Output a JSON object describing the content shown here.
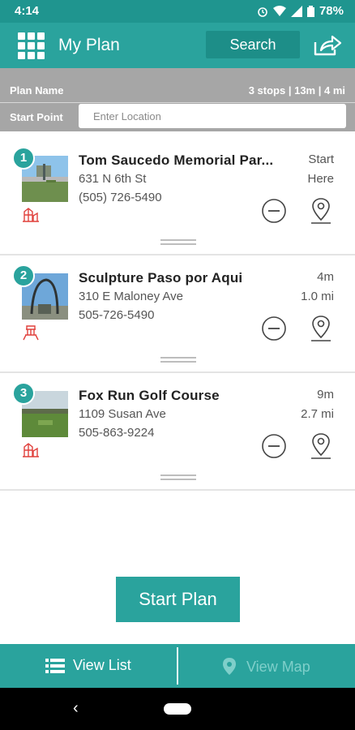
{
  "status": {
    "time": "4:14",
    "battery": "78%"
  },
  "header": {
    "title": "My Plan",
    "search_label": "Search"
  },
  "plan": {
    "name_label": "Plan Name",
    "stats": "3 stops | 13m | 4 mi",
    "start_label": "Start Point",
    "start_placeholder": "Enter Location"
  },
  "stops": [
    {
      "num": "1",
      "name": "Tom Saucedo Memorial Par...",
      "address": "631 N 6th St",
      "phone": "(505) 726-5490",
      "meta1": "Start",
      "meta2": "Here"
    },
    {
      "num": "2",
      "name": "Sculpture Paso por Aqui",
      "address": "310 E Maloney Ave",
      "phone": "505-726-5490",
      "meta1": "4m",
      "meta2": "1.0 mi"
    },
    {
      "num": "3",
      "name": "Fox Run Golf Course",
      "address": "1109 Susan Ave",
      "phone": "505-863-9224",
      "meta1": "9m",
      "meta2": "2.7 mi"
    }
  ],
  "actions": {
    "start_plan": "Start Plan"
  },
  "tabs": {
    "view_list": "View List",
    "view_map": "View Map"
  },
  "colors": {
    "accent": "#2aa39d",
    "accent_dark": "#1d8e88",
    "category_red": "#e0403c"
  }
}
